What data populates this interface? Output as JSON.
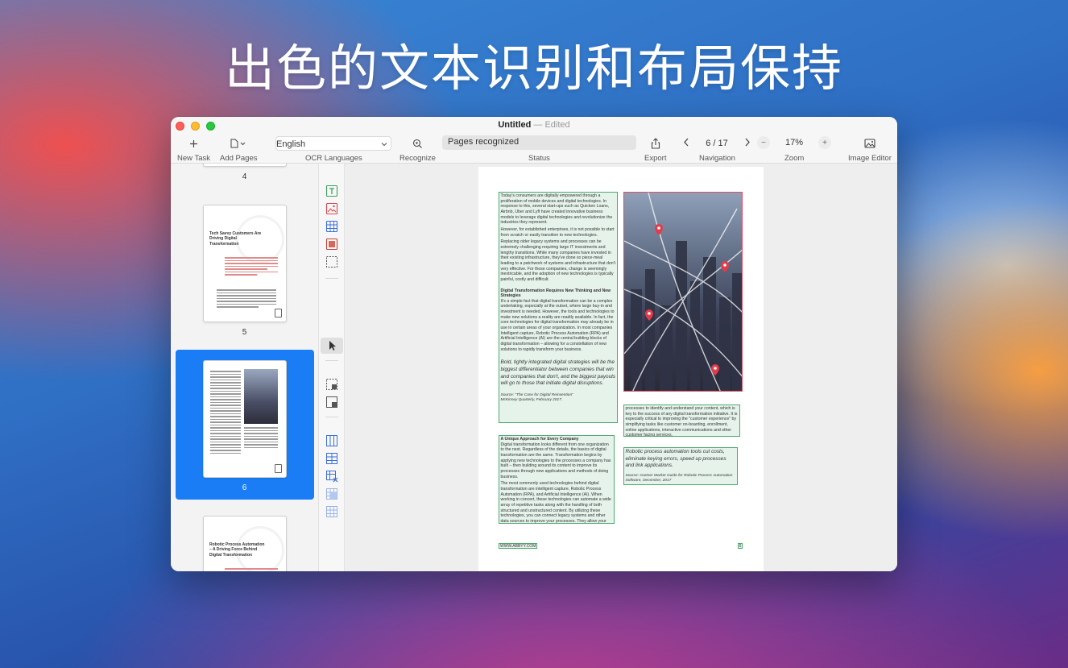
{
  "hero": {
    "title": "出色的文本识别和布局保持"
  },
  "window": {
    "title": "Untitled",
    "separator": "—",
    "edited": "Edited"
  },
  "toolbar": {
    "new_task": "New Task",
    "add_pages": "Add Pages",
    "ocr_languages": "OCR Languages",
    "language_value": "English",
    "recognize": "Recognize",
    "status": "Status",
    "status_value": "Pages recognized",
    "export": "Export",
    "navigation": "Navigation",
    "page_indicator": "6 / 17",
    "zoom": "Zoom",
    "zoom_value": "17%",
    "image_editor": "Image Editor"
  },
  "sidebar": {
    "pages": [
      {
        "num": "4"
      },
      {
        "num": "5",
        "title": "Tech Savvy Customers Are Driving Digital Transformation"
      },
      {
        "num": "6",
        "selected": true
      },
      {
        "title": "Robotic Process Automation – A Driving Force Behind Digital Transformation"
      }
    ]
  },
  "document": {
    "col1_p1": "Today's consumers are digitally empowered through a proliferation of mobile devices and digital technologies. In response to this, several start-ups such as Quicken Loans, Airbnb, Uber and Lyft have created innovative business models to leverage digital technologies and revolutionize the industries they represent.",
    "col1_p2": "However, for established enterprises, it is not possible to start from scratch or easily transition to new technologies.",
    "col1_p3": "Replacing older legacy systems and processes can be extremely challenging requiring large IT investments and lengthy transitions. While many companies have invested in their existing infrastructure, they've done so piece-meal leading to a patchwork of systems and infrastructure that don't very effective. For those companies, change is seemingly inextricable, and the adoption of new technologies is typically painful, costly and difficult.",
    "col1_h": "Digital Transformation Requires New Thinking and New Strategies",
    "col1_p4": "It's a simple fact that digital transformation can be a complex undertaking, especially at the outset, where large buy-in and investment is needed. However, the tools and technologies to make new solutions a reality are readily available. In fact, the core technologies for digital transformation may already be in use in certain areas of your organization. In most companies Intelligent capture, Robotic Process Automation (RPA) and Artificial Intelligence (AI) are the central building blocks of digital transformation – allowing for a constellation of new solutions to rapidly transform your business.",
    "col1_quote": "Bold, tightly integrated digital strategies will be the biggest differentiator between companies that win and companies that don't, and the biggest payouts will go to those that initiate digital disruptions.",
    "col1_src1": "Source: \"The Case for Digital Reinvention\"",
    "col1_src2": "McKinsey Quarterly, February 2017.",
    "col1b_h": "A Unique Approach for Every Company",
    "col1b_p1": "Digital transformation looks different from one organization to the next. Regardless of the details, the basics of digital transformation are the same. Transformation begins by applying new technologies to the processes a company has built – then building around its content to improve its processes through new applications and methods of doing business.",
    "col1b_p2": "The most commonly used technologies behind digital transformation are intelligent capture, Robotic Process Automation (RPA), and Artificial Intelligence (AI). When working in concert, these technologies can automate a wide array of repetitive tasks along with the handling of both structured and unstructured content. By utilizing these technologies, you can connect legacy systems and other data sources to improve your processes. They allow your",
    "col2_p1": "processes to identify and understand your content, which is key to the success of any digital transformation initiative. It is especially critical to improving the \"customer experience\" by simplifying tasks like customer on-boarding, enrollment, online applications, interactive communications and other customer facing services.",
    "col2_quote": "Robotic process automation tools cut costs, eliminate keying errors, speed up processes and link applications.",
    "col2_src1": "Source: Gartner Market Guide for Robotic Process Automation",
    "col2_src2": "Software, December, 2017",
    "footer_link": "WWW.ABBYY.COM",
    "footer_page": "6"
  },
  "colors": {
    "accent": "#1a7df5",
    "text_zone": "#4caa6f",
    "picture_zone": "#e05060"
  }
}
